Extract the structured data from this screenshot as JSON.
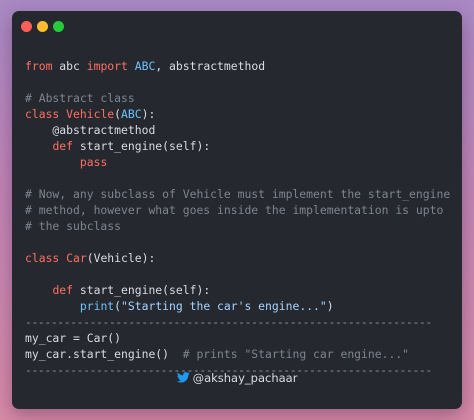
{
  "window": {
    "controls": {
      "close_color": "#ff5f56",
      "minimize_color": "#ffbd2e",
      "maximize_color": "#27c93f"
    }
  },
  "code": {
    "lines": [
      [
        {
          "t": "from",
          "c": "kw"
        },
        {
          "t": " abc ",
          "c": "plain"
        },
        {
          "t": "import",
          "c": "kw"
        },
        {
          "t": " ",
          "c": "plain"
        },
        {
          "t": "ABC",
          "c": "builtin"
        },
        {
          "t": ", abstractmethod",
          "c": "plain"
        }
      ],
      [],
      [
        {
          "t": "# Abstract class",
          "c": "comment"
        }
      ],
      [
        {
          "t": "class",
          "c": "kw"
        },
        {
          "t": " ",
          "c": "plain"
        },
        {
          "t": "Vehicle",
          "c": "cls"
        },
        {
          "t": "(",
          "c": "plain"
        },
        {
          "t": "ABC",
          "c": "builtin"
        },
        {
          "t": "):",
          "c": "plain"
        }
      ],
      [
        {
          "t": "    @abstractmethod",
          "c": "plain"
        }
      ],
      [
        {
          "t": "    ",
          "c": "plain"
        },
        {
          "t": "def",
          "c": "kw"
        },
        {
          "t": " start_engine(self):",
          "c": "plain"
        }
      ],
      [
        {
          "t": "        ",
          "c": "plain"
        },
        {
          "t": "pass",
          "c": "kw"
        }
      ],
      [],
      [
        {
          "t": "# Now, any subclass of Vehicle must implement the start_engine",
          "c": "comment"
        }
      ],
      [
        {
          "t": "# method, however what goes inside the implementation is upto",
          "c": "comment"
        }
      ],
      [
        {
          "t": "# the subclass",
          "c": "comment"
        }
      ],
      [],
      [
        {
          "t": "class",
          "c": "kw"
        },
        {
          "t": " ",
          "c": "plain"
        },
        {
          "t": "Car",
          "c": "cls"
        },
        {
          "t": "(Vehicle):",
          "c": "plain"
        }
      ],
      [],
      [
        {
          "t": "    ",
          "c": "plain"
        },
        {
          "t": "def",
          "c": "kw"
        },
        {
          "t": " start_engine(self):",
          "c": "plain"
        }
      ],
      [
        {
          "t": "        ",
          "c": "plain"
        },
        {
          "t": "print",
          "c": "builtin"
        },
        {
          "t": "(",
          "c": "plain"
        },
        {
          "t": "\"Starting the car's engine...\"",
          "c": "str"
        },
        {
          "t": ")",
          "c": "plain"
        }
      ],
      [
        {
          "t": "---------------------------------------------------------------",
          "c": "sep"
        }
      ],
      [
        {
          "t": "my_car = Car()",
          "c": "plain"
        }
      ],
      [
        {
          "t": "my_car.start_engine()  ",
          "c": "plain"
        },
        {
          "t": "# prints \"Starting car engine...\"",
          "c": "comment"
        }
      ],
      [
        {
          "t": "---------------------------------------------------------------",
          "c": "sep"
        }
      ]
    ]
  },
  "footer": {
    "handle": "@akshay_pachaar",
    "icon": "twitter-bird-icon",
    "icon_color": "#1d9bf0"
  }
}
